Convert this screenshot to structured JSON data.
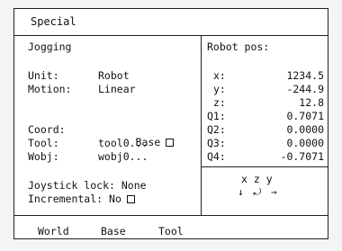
{
  "window": {
    "title": "Special"
  },
  "jogging": {
    "heading": "Jogging",
    "unit": {
      "label": "Unit:",
      "value": "Robot"
    },
    "motion": {
      "label": "Motion:",
      "value": "Linear"
    },
    "coord": {
      "label": "Coord:",
      "value": "Base"
    },
    "tool": {
      "label": "Tool:",
      "value": "tool0..."
    },
    "wobj": {
      "label": "Wobj:",
      "value": "wobj0..."
    },
    "joystick_lock": {
      "label": "Joystick lock:",
      "value": "None"
    },
    "incremental": {
      "label": "Incremental:",
      "value": "No"
    }
  },
  "robot_pos": {
    "heading": "Robot pos:",
    "rows": [
      {
        "label": "x:",
        "value": "1234.5"
      },
      {
        "label": "y:",
        "value": "-244.9"
      },
      {
        "label": "z:",
        "value": "12.8"
      },
      {
        "label": "Q1:",
        "value": "0.7071"
      },
      {
        "label": "Q2:",
        "value": "0.0000"
      },
      {
        "label": "Q3:",
        "value": "0.0000"
      },
      {
        "label": "Q4:",
        "value": "-0.7071"
      }
    ]
  },
  "joystick_dirs": {
    "axes": "x z y"
  },
  "footer": {
    "buttons": [
      "World",
      "Base",
      "Tool"
    ]
  }
}
